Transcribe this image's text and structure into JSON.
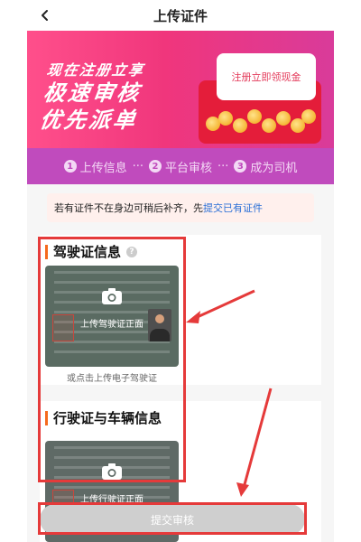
{
  "header": {
    "title": "上传证件"
  },
  "banner": {
    "promo_line1": "现在注册立享",
    "promo_line2": "极速审核",
    "promo_line3": "优先派单",
    "envelope_text": "注册立即领现金"
  },
  "steps": [
    {
      "num": "1",
      "label": "上传信息"
    },
    {
      "num": "2",
      "label": "平台审核"
    },
    {
      "num": "3",
      "label": "成为司机"
    }
  ],
  "steps_separator": "···",
  "notice": {
    "text": "若有证件不在身边可稍后补齐，先",
    "link": "提交已有证件"
  },
  "driver_license": {
    "title": "驾驶证信息",
    "info_icon": "?",
    "upload_label": "上传驾驶证正面",
    "alt_link": "或点击上传电子驾驶证"
  },
  "vehicle_license": {
    "title": "行驶证与车辆信息",
    "upload_label": "上传行驶证正面"
  },
  "submit": {
    "label": "提交审核"
  },
  "colors": {
    "annotation": "#e53a3a",
    "banner_pink": "#f0367c",
    "steps_purple": "#c04bbd",
    "link_blue": "#2b6fd6",
    "accent_orange": "#f56a1d"
  }
}
